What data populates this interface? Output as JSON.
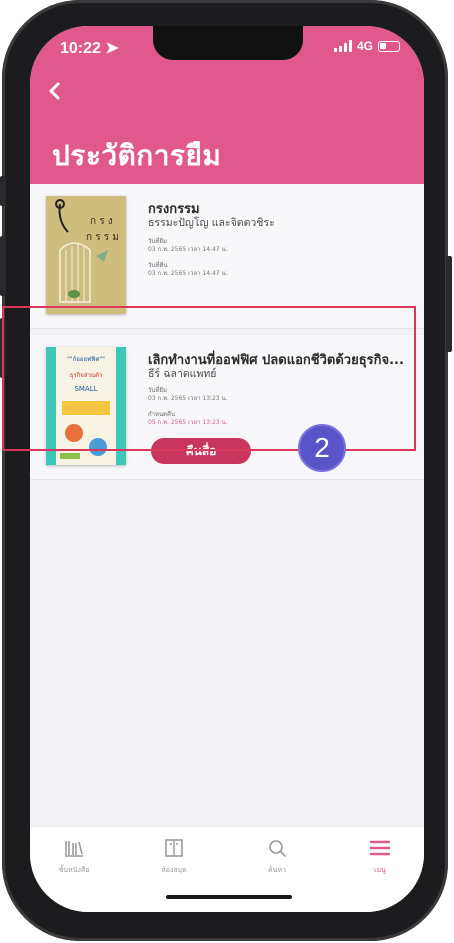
{
  "status_bar": {
    "time": "10:22",
    "network": "4G"
  },
  "header": {
    "title": "ประวัติการยืม"
  },
  "books": [
    {
      "title": "กรงกรรม",
      "author": "ธรรมะปัญโญ และจิตตวชิระ",
      "borrowed_label": "วันที่ยืม",
      "borrowed_date": "03 ก.พ. 2565 เวลา 14:47 น.",
      "returned_label": "วันที่คืน",
      "returned_date": "03 ก.พ. 2565 เวลา 14:47 น.",
      "cover_lines": [
        "ก ร ง",
        "ก ร ร ม"
      ]
    },
    {
      "title": "เลิกทำงานที่ออฟฟิศ ปลดแอกชีวิตด้วยธุรกิจ...",
      "author": "ธีร์ ฉลาดแพทย์",
      "borrowed_label": "วันที่ยืม",
      "borrowed_date": "03 ก.พ. 2565 เวลา 13:23 น.",
      "due_label": "กำหนดคืน",
      "due_date": "05 ก.พ. 2565 เวลา 13:23 น.",
      "return_button": "คืนสื่อ",
      "cover_lines": [
        "\"\"ก้อออฟฟิศ\"\"",
        "ธุรกิจส่วนตัว",
        "SMALL"
      ]
    }
  ],
  "step_badge": "2",
  "tabs": [
    {
      "label": "ชั้นหนังสือ",
      "icon": "bookshelf-icon",
      "active": false
    },
    {
      "label": "ห้องสมุด",
      "icon": "library-icon",
      "active": false
    },
    {
      "label": "ค้นหา",
      "icon": "search-icon",
      "active": false
    },
    {
      "label": "เมนู",
      "icon": "menu-icon",
      "active": true
    }
  ],
  "colors": {
    "brand": "#e0588c",
    "button": "#c8355f",
    "highlight": "#d7375a",
    "badge": "#5b53c8"
  }
}
